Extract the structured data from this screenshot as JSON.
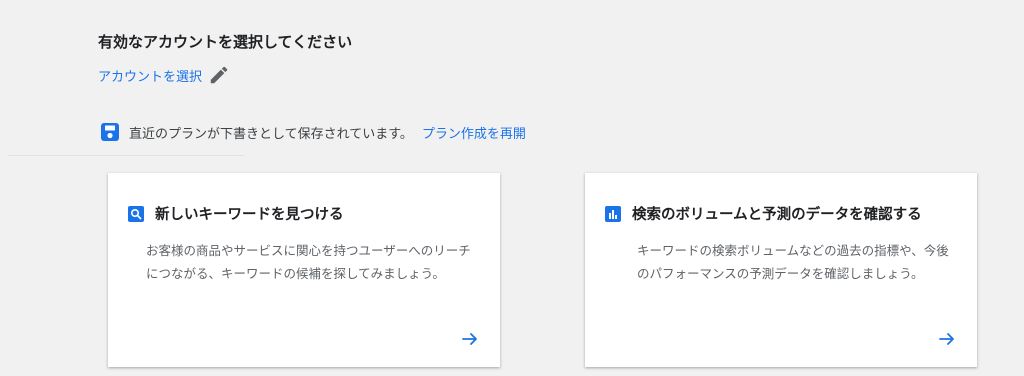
{
  "heading": "有効なアカウントを選択してください",
  "account": {
    "link_label": "アカウントを選択",
    "edit_icon": "pencil-icon"
  },
  "draft": {
    "icon": "save-icon",
    "message": "直近のプランが下書きとして保存されています。",
    "resume_label": "プラン作成を再開"
  },
  "cards": [
    {
      "icon": "search-icon",
      "title": "新しいキーワードを見つける",
      "description": "お客様の商品やサービスに関心を持つユーザーへのリーチにつながる、キーワードの候補を探してみましょう。",
      "arrow_icon": "arrow-right-icon"
    },
    {
      "icon": "bar-chart-icon",
      "title": "検索のボリュームと予測のデータを確認する",
      "description": "キーワードの検索ボリュームなどの過去の指標や、今後のパフォーマンスの予測データを確認しましょう。",
      "arrow_icon": "arrow-right-icon"
    }
  ],
  "colors": {
    "accent": "#1a73e8",
    "background": "#f1f1f1",
    "card": "#ffffff",
    "text_primary": "#202124",
    "text_secondary": "#5f6368"
  }
}
